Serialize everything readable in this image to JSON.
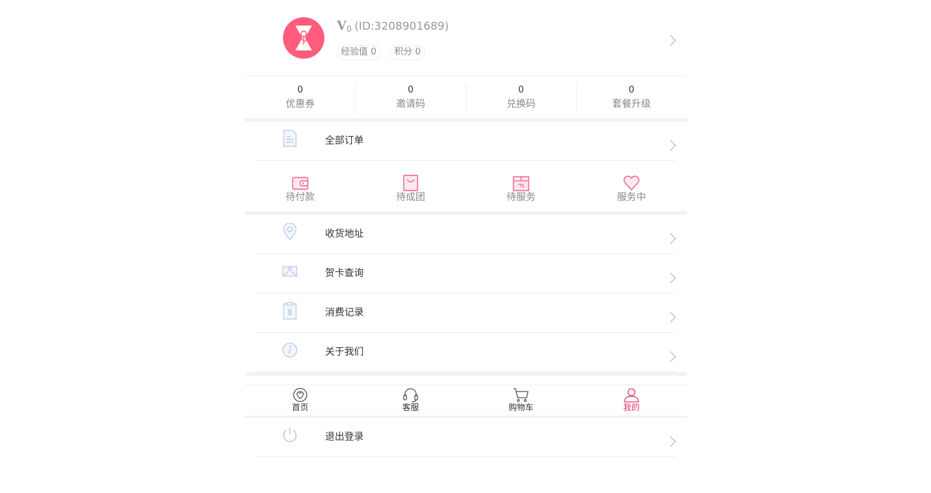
{
  "profile": {
    "vip_mark": "V",
    "vip_level": "0",
    "user_id": "(ID:3208901689)",
    "experience_label": "经验值 0",
    "points_label": "积分 0"
  },
  "stats": [
    {
      "value": "0",
      "label": "优惠券"
    },
    {
      "value": "0",
      "label": "邀请码"
    },
    {
      "value": "0",
      "label": "兑换码"
    },
    {
      "value": "0",
      "label": "套餐升级"
    }
  ],
  "all_orders_label": "全部订单",
  "orders": [
    {
      "label": "待付款",
      "icon": "wallet-icon"
    },
    {
      "label": "待成团",
      "icon": "bag-icon"
    },
    {
      "label": "待服务",
      "icon": "box-icon"
    },
    {
      "label": "服务中",
      "icon": "heart-icon"
    }
  ],
  "menu": [
    {
      "label": "收货地址",
      "icon": "location-icon"
    },
    {
      "label": "贺卡查询",
      "icon": "card-icon"
    },
    {
      "label": "消费记录",
      "icon": "receipt-icon"
    },
    {
      "label": "关于我们",
      "icon": "info-icon"
    }
  ],
  "tabbar": [
    {
      "label": "首页",
      "icon": "rose-icon"
    },
    {
      "label": "客服",
      "icon": "headset-icon"
    },
    {
      "label": "购物车",
      "icon": "cart-icon"
    },
    {
      "label": "我的",
      "icon": "user-icon",
      "active": true
    }
  ],
  "logout_label": "退出登录",
  "colors": {
    "accent": "#e6396a",
    "avatar_bg": "#ff5c7c",
    "icon_pink": "#f0608a",
    "icon_blue": "#b7c7e6"
  }
}
